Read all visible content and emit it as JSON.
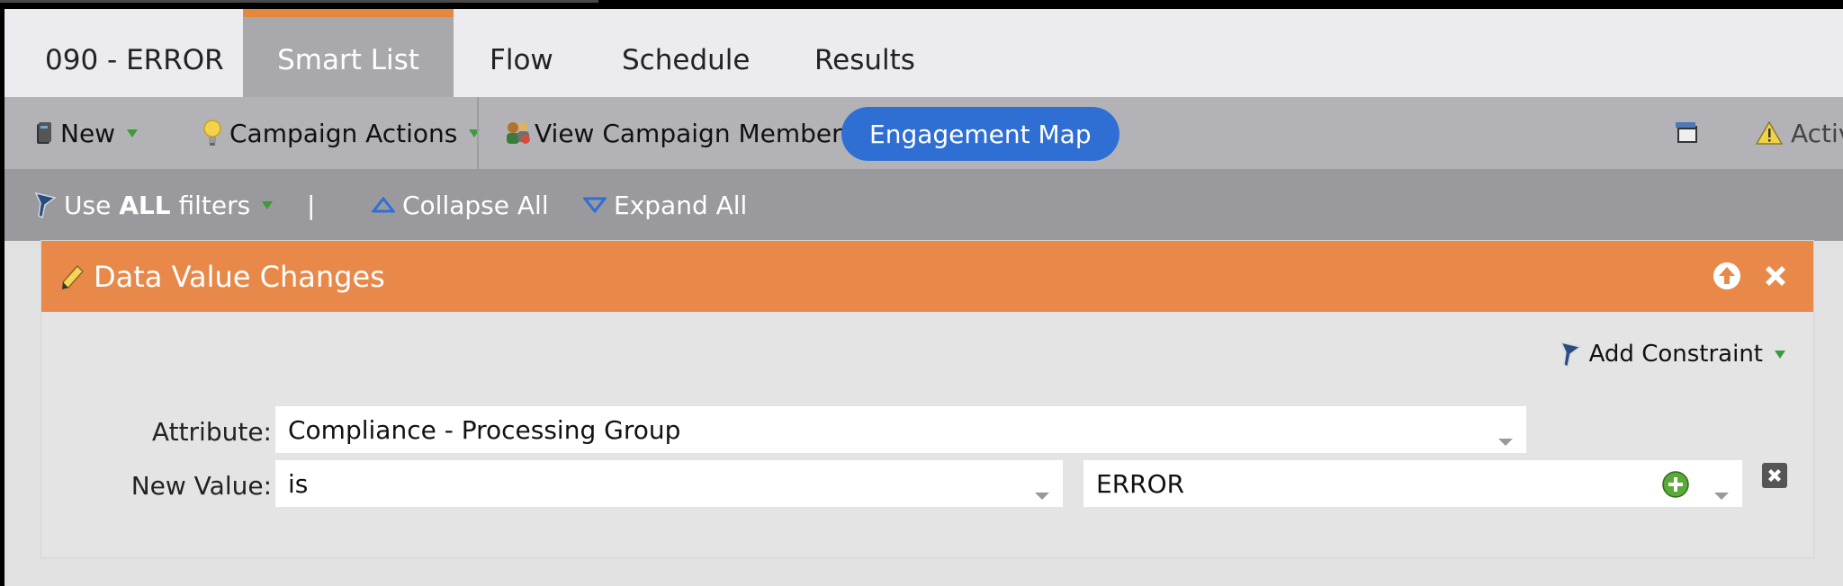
{
  "tabs": [
    {
      "label": "090 - ERROR",
      "active": false
    },
    {
      "label": "Smart List",
      "active": true
    },
    {
      "label": "Flow",
      "active": false
    },
    {
      "label": "Schedule",
      "active": false
    },
    {
      "label": "Results",
      "active": false
    }
  ],
  "toolbar": {
    "new_label": "New",
    "campaign_actions_label": "Campaign Actions",
    "view_members_label": "View Campaign Members",
    "engagement_map_label": "Engagement Map",
    "status_label": "Activ"
  },
  "filterbar": {
    "use_prefix": "Use ",
    "use_bold": "ALL",
    "use_suffix": " filters",
    "separator": "|",
    "collapse_label": "Collapse All",
    "expand_label": "Expand All"
  },
  "filter": {
    "title": "Data Value Changes",
    "add_constraint_label": "Add Constraint",
    "attribute_label": "Attribute:",
    "attribute_value": "Compliance - Processing Group",
    "new_value_label": "New Value:",
    "operator_value": "is",
    "value": "ERROR"
  },
  "colors": {
    "accent_orange": "#e8894a",
    "tab_active_bar": "#e5883b",
    "pill_blue": "#2f6fd3"
  }
}
